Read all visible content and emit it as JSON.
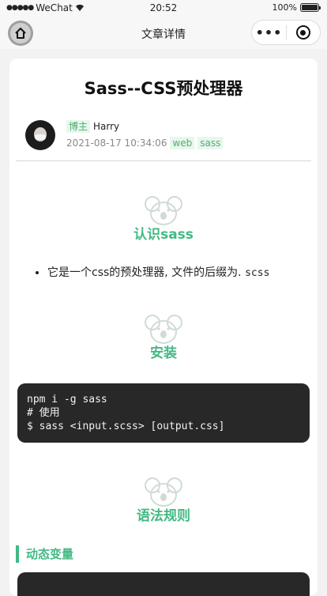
{
  "statusbar": {
    "carrier": "WeChat",
    "time": "20:52",
    "battery": "100%"
  },
  "navbar": {
    "title": "文章详情"
  },
  "article": {
    "title": "Sass--CSS预处理器",
    "author_badge": "博主",
    "author": "Harry",
    "datetime": "2021-08-17 10:34:06",
    "tags": [
      "web",
      "sass"
    ]
  },
  "sections": {
    "s1": {
      "title": "认识sass",
      "bullet_text": "它是一个css的预处理器, 文件的后缀为. ",
      "bullet_code": "scss"
    },
    "s2": {
      "title": "安装",
      "code_lines": [
        "npm i -g sass",
        "# 使用",
        "$ sass <input.scss> [output.css]"
      ]
    },
    "s3": {
      "title": "语法规则",
      "subtitle": "动态变量"
    }
  },
  "colors": {
    "accent": "#42b983",
    "code_bg": "#282828"
  }
}
